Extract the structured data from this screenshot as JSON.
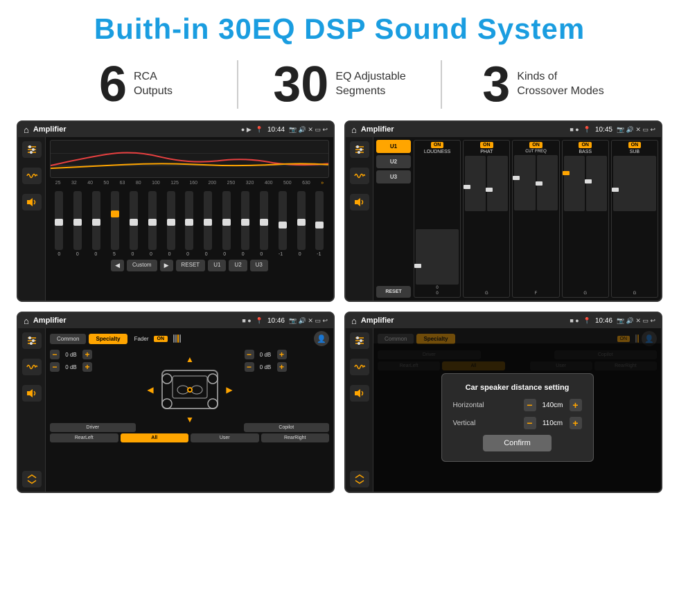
{
  "title": "Buith-in 30EQ DSP Sound System",
  "stats": [
    {
      "number": "6",
      "text": "RCA\nOutputs"
    },
    {
      "number": "30",
      "text": "EQ Adjustable\nSegments"
    },
    {
      "number": "3",
      "text": "Kinds of\nCrossover Modes"
    }
  ],
  "screens": [
    {
      "id": "eq-screen",
      "statusBar": {
        "appName": "Amplifier",
        "time": "10:44",
        "icons": "▶ ⚙ ☑ □ ↩"
      },
      "type": "eq"
    },
    {
      "id": "amp2-screen",
      "statusBar": {
        "appName": "Amplifier",
        "time": "10:45",
        "icons": "■ ● ⚙ ☑ □ ↩"
      },
      "type": "amp2"
    },
    {
      "id": "fader-screen",
      "statusBar": {
        "appName": "Amplifier",
        "time": "10:46",
        "icons": "■ ● ⚙ ☑ □ ↩"
      },
      "type": "fader"
    },
    {
      "id": "dialog-screen",
      "statusBar": {
        "appName": "Amplifier",
        "time": "10:46",
        "icons": "■ ● ⚙ ☑ □ ↩"
      },
      "type": "dialog"
    }
  ],
  "dialog": {
    "title": "Car speaker distance setting",
    "horizontal_label": "Horizontal",
    "horizontal_value": "140cm",
    "vertical_label": "Vertical",
    "vertical_value": "110cm",
    "confirm_label": "Confirm"
  },
  "eq": {
    "frequencies": [
      "25",
      "32",
      "40",
      "50",
      "63",
      "80",
      "100",
      "125",
      "160",
      "200",
      "250",
      "320",
      "400",
      "500",
      "630"
    ],
    "values": [
      "0",
      "0",
      "0",
      "5",
      "0",
      "0",
      "0",
      "0",
      "0",
      "0",
      "0",
      "0",
      "-1",
      "0",
      "-1"
    ],
    "presets": [
      "Custom",
      "RESET",
      "U1",
      "U2",
      "U3"
    ]
  },
  "amp2": {
    "presets": [
      "U1",
      "U2",
      "U3"
    ],
    "channels": [
      "LOUDNESS",
      "PHAT",
      "CUT FREQ",
      "BASS",
      "SUB"
    ],
    "resetLabel": "RESET"
  },
  "fader": {
    "tabs": [
      "Common",
      "Specialty"
    ],
    "faderLabel": "Fader",
    "onLabel": "ON",
    "volumes": [
      "0 dB",
      "0 dB",
      "0 dB",
      "0 dB"
    ],
    "bottomBtns": [
      "Driver",
      "",
      "Copilot",
      "RearLeft",
      "All",
      "",
      "User",
      "RearRight"
    ]
  }
}
